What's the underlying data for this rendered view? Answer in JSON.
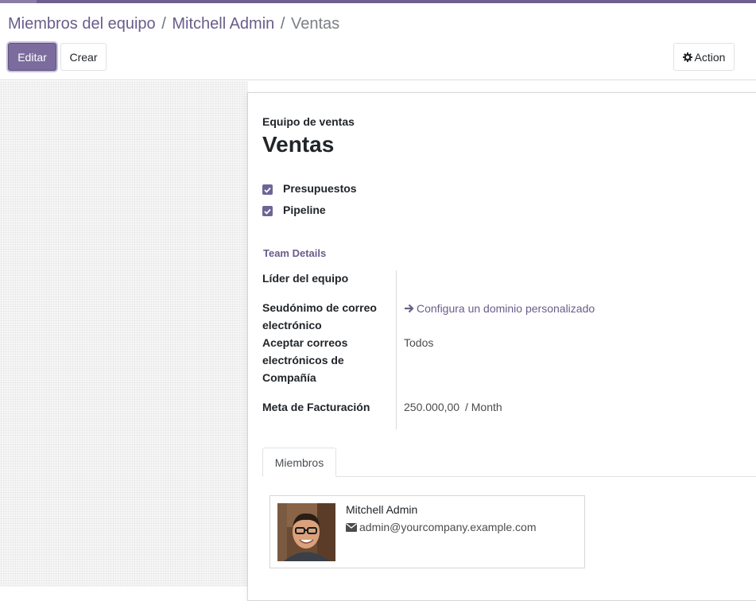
{
  "breadcrumb": {
    "items": [
      "Miembros del equipo",
      "Mitchell Admin"
    ],
    "separator": "/",
    "current": "Ventas"
  },
  "buttons": {
    "edit": "Editar",
    "create": "Crear",
    "action": "Action"
  },
  "record": {
    "type_label": "Equipo de ventas",
    "name": "Ventas",
    "checkboxes": [
      {
        "label": "Presupuestos",
        "checked": true
      },
      {
        "label": "Pipeline",
        "checked": true
      }
    ]
  },
  "team_details": {
    "title": "Team Details",
    "leader_label": "Líder del equipo",
    "alias_label": "Seudónimo de correo electrónico",
    "alias_link": "Configura un dominio personalizado",
    "accept_label": "Aceptar correos electrónicos de Compañía",
    "accept_value": "Todos",
    "target_label": "Meta de Facturación",
    "target_value": "250.000,00",
    "target_period": "/ Month"
  },
  "tabs": {
    "members": "Miembros"
  },
  "members": [
    {
      "name": "Mitchell Admin",
      "email": "admin@yourcompany.example.com"
    }
  ],
  "colors": {
    "brand": "#7c6c9e",
    "link": "#6a5c8a"
  }
}
